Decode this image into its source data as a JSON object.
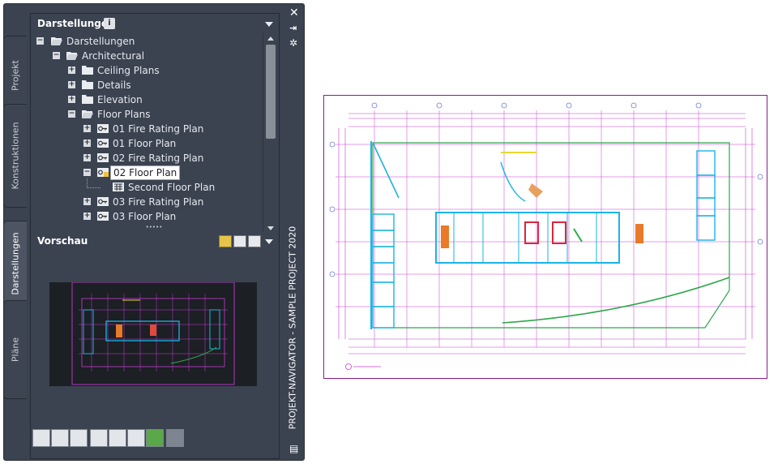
{
  "palette": {
    "title": "PROJEKT-NAVIGATOR - SAMPLE PROJECT 2020",
    "tabs": [
      "Projekt",
      "Konstruktionen",
      "Darstellungen",
      "Pläne"
    ],
    "active_tab": "Darstellungen",
    "close_icon": "close-icon",
    "pin_icon": "autohide-icon",
    "properties_icon": "properties-icon"
  },
  "tree_section": {
    "title": "Darstellungen",
    "info_badge": "i",
    "items": [
      {
        "label": "Darstellungen",
        "toggle": "−",
        "icon": "folder-open-icon",
        "level": 0
      },
      {
        "label": "Architectural",
        "toggle": "−",
        "icon": "folder-open-icon",
        "level": 1
      },
      {
        "label": "Ceiling Plans",
        "toggle": "+",
        "icon": "folder-icon",
        "level": 2
      },
      {
        "label": "Details",
        "toggle": "+",
        "icon": "folder-icon",
        "level": 2
      },
      {
        "label": "Elevation",
        "toggle": "+",
        "icon": "folder-icon",
        "level": 2
      },
      {
        "label": "Floor Plans",
        "toggle": "−",
        "icon": "folder-open-icon",
        "level": 2
      },
      {
        "label": "01 Fire Rating Plan",
        "toggle": "+",
        "icon": "view-drawing-icon",
        "level": 3
      },
      {
        "label": "01 Floor Plan",
        "toggle": "+",
        "icon": "view-drawing-icon",
        "level": 3
      },
      {
        "label": "02 Fire Rating Plan",
        "toggle": "+",
        "icon": "view-drawing-icon",
        "level": 3
      },
      {
        "label": "02 Floor Plan",
        "toggle": "−",
        "icon": "view-drawing-locked-icon",
        "level": 3,
        "selected": true
      },
      {
        "label": "Second Floor Plan",
        "toggle": "",
        "icon": "model-view-icon",
        "level": 4
      },
      {
        "label": "03 Fire Rating Plan",
        "toggle": "+",
        "icon": "view-drawing-icon",
        "level": 3
      },
      {
        "label": "03 Floor Plan",
        "toggle": "+",
        "icon": "view-drawing-icon",
        "level": 3
      }
    ]
  },
  "preview_section": {
    "title": "Vorschau",
    "grip": "•••••"
  },
  "toolbar": {
    "buttons": [
      "add-view-icon",
      "add-view-options-icon",
      "edit-view-icon",
      "delete-icon",
      "select-icon",
      "list-icon",
      "refresh-icon",
      "repath-icon"
    ]
  },
  "colors": {
    "panel_bg": "#3b4250",
    "plan_magenta": "#c83cd2",
    "plan_cyan": "#1ab4e6",
    "plan_green": "#2ea84a",
    "plan_frame": "#8b1a8f"
  }
}
